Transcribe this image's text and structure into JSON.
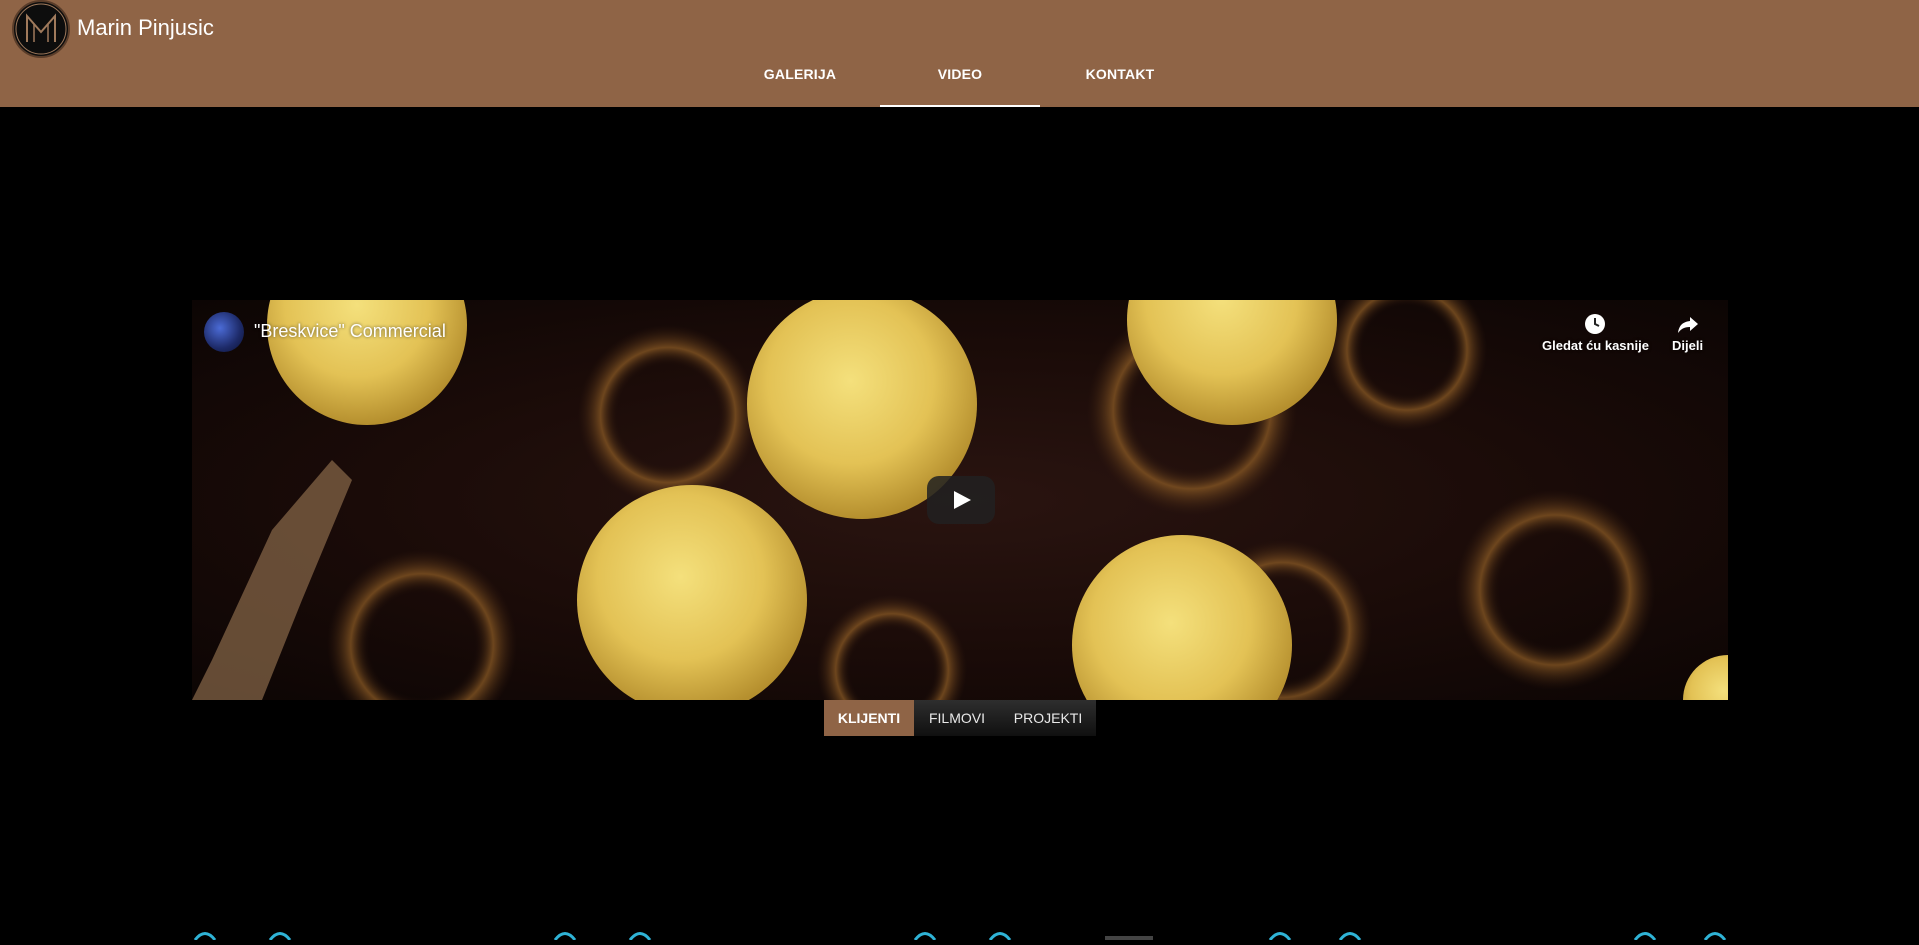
{
  "header": {
    "site_title": "Marin Pinjusic",
    "logo_icon": "mp-monogram-logo",
    "background_color": "#8f6446"
  },
  "nav": {
    "tabs": [
      {
        "label": "GALERIJA",
        "active": false
      },
      {
        "label": "VIDEO",
        "active": true
      },
      {
        "label": "KONTAKT",
        "active": false
      }
    ]
  },
  "video": {
    "title": "\"Breskvice\" Commercial",
    "channel_avatar_icon": "channel-avatar",
    "watch_later_label": "Gledat ću kasnije",
    "watch_later_icon": "clock-icon",
    "share_label": "Dijeli",
    "share_icon": "share-arrow-icon",
    "play_icon": "play-icon"
  },
  "categories": {
    "tabs": [
      {
        "label": "KLIJENTI",
        "active": true
      },
      {
        "label": "FILMOVI",
        "active": false
      },
      {
        "label": "PROJEKTI",
        "active": false
      }
    ],
    "accent_color": "#8f6446"
  }
}
